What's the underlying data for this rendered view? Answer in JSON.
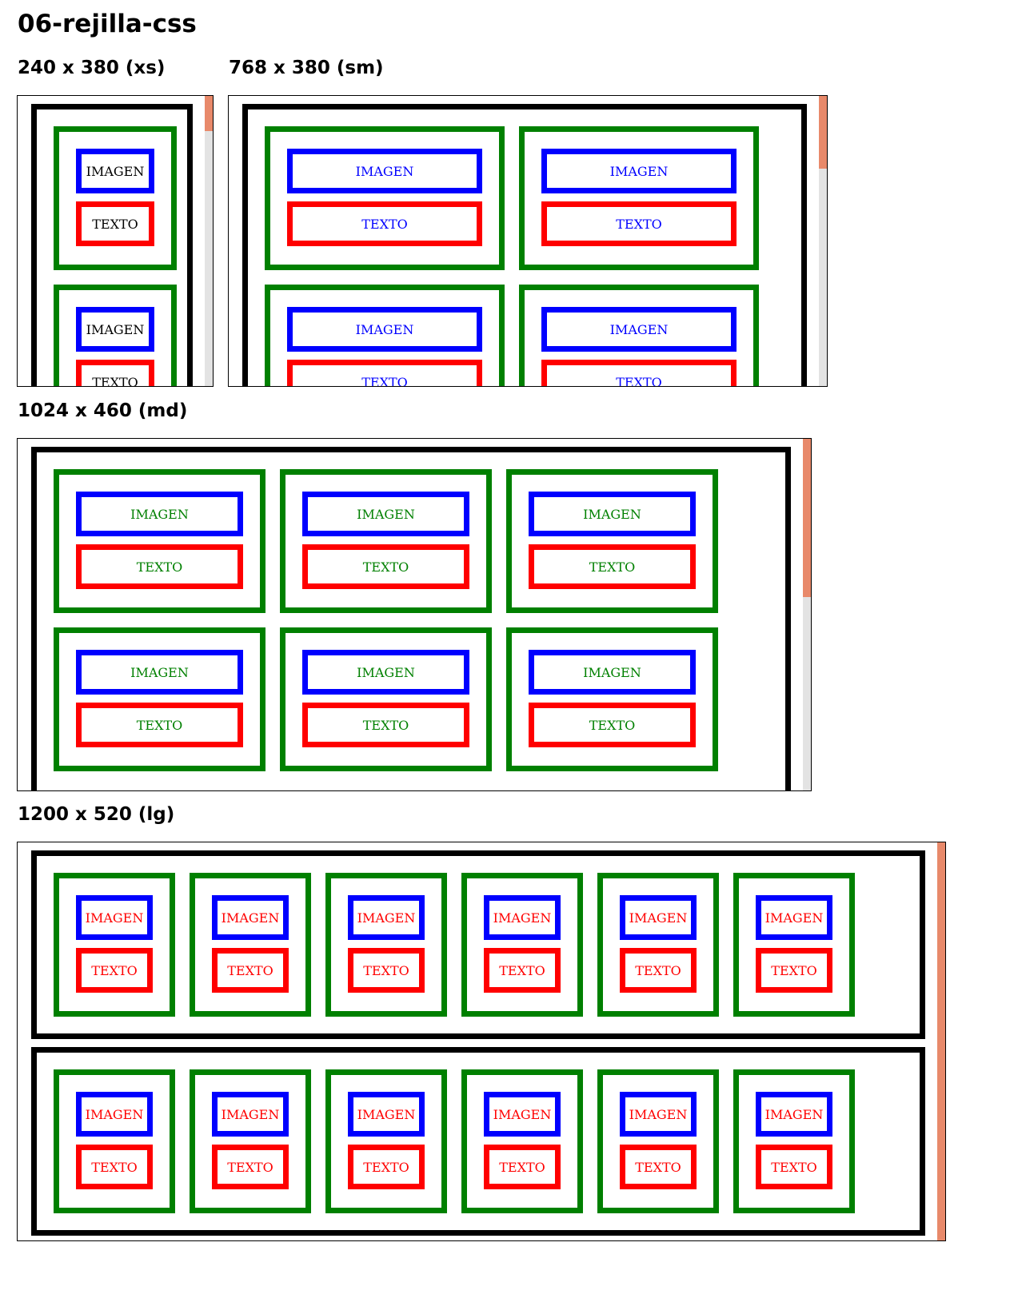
{
  "page": {
    "title": "06-rejilla-css"
  },
  "frames": [
    {
      "id": "xs",
      "label": "240 x 380 (xs)",
      "text_color": "#000000",
      "image_label": "IMAGEN",
      "text_label": "TEXTO",
      "scroll_fraction": 0.12
    },
    {
      "id": "sm",
      "label": "768 x 380 (sm)",
      "text_color": "#0000ff",
      "image_label": "IMAGEN",
      "text_label": "TEXTO",
      "scroll_fraction": 0.25
    },
    {
      "id": "md",
      "label": "1024 x 460 (md)",
      "text_color": "#008000",
      "image_label": "IMAGEN",
      "text_label": "TEXTO",
      "scroll_fraction": 0.45
    },
    {
      "id": "lg",
      "label": "1200 x 520 (lg)",
      "text_color": "#ff0000",
      "image_label": "IMAGEN",
      "text_label": "TEXTO",
      "scroll_fraction": 1.0
    }
  ],
  "colors": {
    "row_border": "#000000",
    "column_border": "#008000",
    "image_border": "#0000ff",
    "text_border": "#ff0000",
    "scrollbar_thumb": "#e8896a",
    "scrollbar_track": "#e3e3e3"
  }
}
